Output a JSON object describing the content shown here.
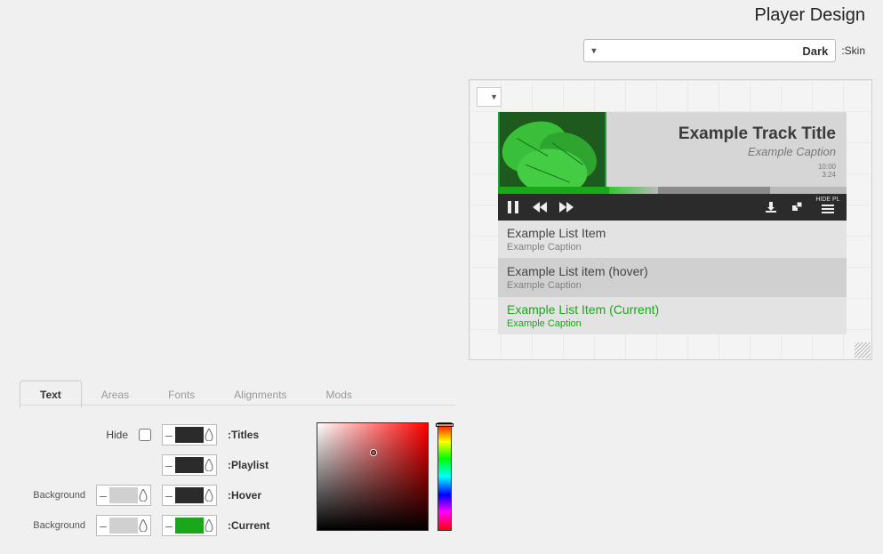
{
  "title": "Player Design",
  "skin": {
    "label": ":Skin",
    "value": "Dark"
  },
  "preview": {
    "track_title": "Example Track Title",
    "track_caption": "Example Caption",
    "time_total": "10:00",
    "time_elapsed": "3:24",
    "hide_pl_label": "HIDE PL",
    "playlist": [
      {
        "title": "Example List Item",
        "caption": "Example Caption",
        "state": "normal"
      },
      {
        "title": "Example List item (hover)",
        "caption": "Example Caption",
        "state": "hover"
      },
      {
        "title": "Example List Item (Current)",
        "caption": "Example Caption",
        "state": "current"
      }
    ]
  },
  "tabs": [
    "Text",
    "Areas",
    "Fonts",
    "Alignments",
    "Mods"
  ],
  "active_tab": "Text",
  "rows": {
    "titles": {
      "label": ":Titles",
      "hide_label": "Hide",
      "color": "#2b2b2b"
    },
    "playlist": {
      "label": ":Playlist",
      "color": "#2b2b2b"
    },
    "hover": {
      "label": ":Hover",
      "bg_label": "Background",
      "bg_color": "#d0d0d0",
      "color": "#2b2b2b"
    },
    "current": {
      "label": ":Current",
      "bg_label": "Background",
      "bg_color": "#d0d0d0",
      "color": "#1aa71a"
    }
  }
}
